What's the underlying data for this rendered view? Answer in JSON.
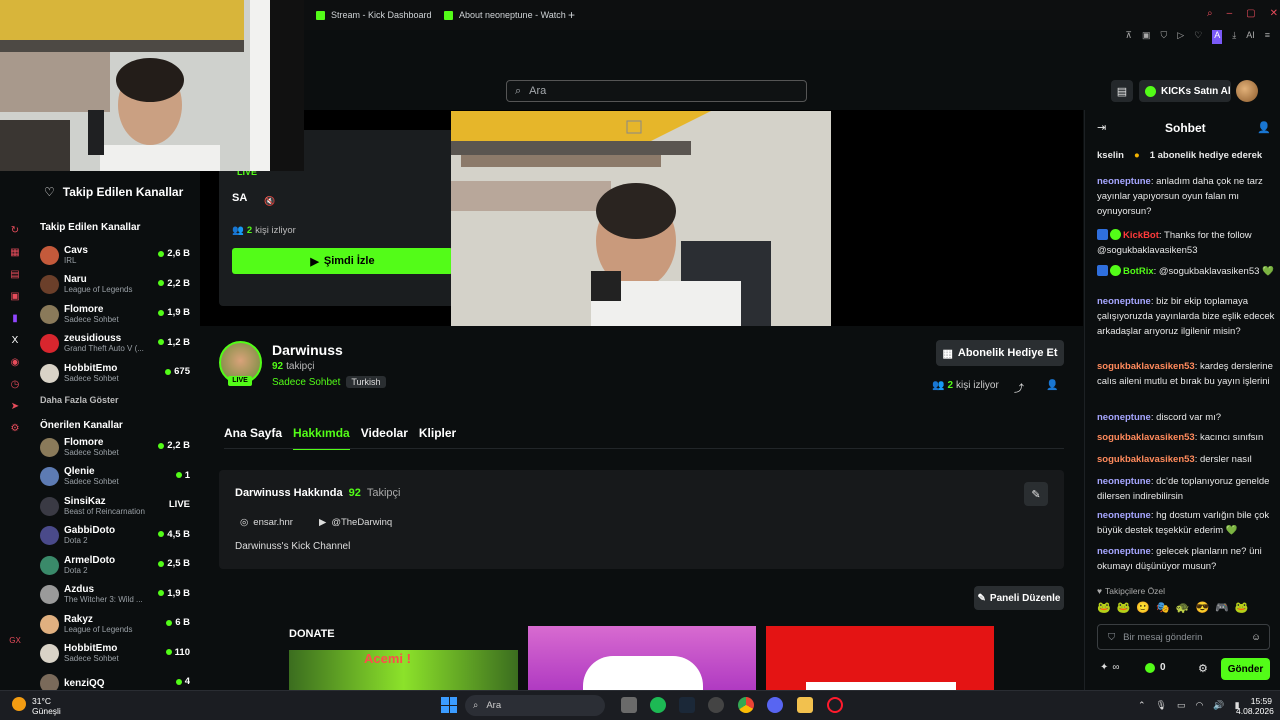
{
  "browser": {
    "tabs": [
      {
        "title": "Stream - Kick Dashboard"
      },
      {
        "title": "About neoneptune - Watch"
      }
    ],
    "new_tab": "+"
  },
  "header": {
    "search_placeholder": "Ara",
    "kicks_button": "KICKs Satın Al"
  },
  "sidebar": {
    "followed_header": "Takip Edilen Kanallar",
    "followed_section": "Takip Edilen Kanallar",
    "followed": [
      {
        "name": "Cavs",
        "category": "IRL",
        "viewers": "2,6 B",
        "color": "#c45a3b"
      },
      {
        "name": "Naru",
        "category": "League of Legends",
        "viewers": "2,2 B",
        "color": "#6b3f2a"
      },
      {
        "name": "Flomore",
        "category": "Sadece Sohbet",
        "viewers": "1,9 B",
        "color": "#8a7a5a"
      },
      {
        "name": "zeusidiouss",
        "category": "Grand Theft Auto V (...",
        "viewers": "1,2 B",
        "color": "#d8262e"
      },
      {
        "name": "HobbitEmo",
        "category": "Sadece Sohbet",
        "viewers": "675",
        "color": "#d9d3c7"
      }
    ],
    "show_more": "Daha Fazla Göster",
    "recommended_section": "Önerilen Kanallar",
    "recommended": [
      {
        "name": "Flomore",
        "category": "Sadece Sohbet",
        "viewers": "2,2 B",
        "color": "#8a7a5a"
      },
      {
        "name": "Qlenie",
        "category": "Sadece Sohbet",
        "viewers": "1",
        "color": "#5d7bb3"
      },
      {
        "name": "SinsiKaz",
        "category": "Beast of Reincarnation",
        "viewers": "LIVE",
        "color": "#3a3a44"
      },
      {
        "name": "GabbiDoto",
        "category": "Dota 2",
        "viewers": "4,5 B",
        "color": "#4a4a8a"
      },
      {
        "name": "ArmelDoto",
        "category": "Dota 2",
        "viewers": "2,5 B",
        "color": "#3a8a6a"
      },
      {
        "name": "Azdus",
        "category": "The Witcher 3: Wild ...",
        "viewers": "1,9 B",
        "color": "#9a9a9a"
      },
      {
        "name": "Rakyz",
        "category": "League of Legends",
        "viewers": "6 B",
        "color": "#e0b080"
      },
      {
        "name": "HobbitEmo",
        "category": "Sadece Sohbet",
        "viewers": "110",
        "color": "#d9d3c7"
      },
      {
        "name": "kenziQQ",
        "category": "",
        "viewers": "4",
        "color": "#7a6a5a"
      }
    ]
  },
  "minicard": {
    "live": "LIVE",
    "title": "SA",
    "viewers_count": "2",
    "viewers_label": "kişi izliyor",
    "watch_button": "Şimdi İzle"
  },
  "channel": {
    "name": "Darwinuss",
    "followers_count": "92",
    "followers_label": "takipçi",
    "category": "Sadece Sohbet",
    "language": "Turkish",
    "live": "LIVE",
    "sub_button": "Abonelik Hediye Et",
    "viewers_count": "2",
    "viewers_label": "kişi izliyor",
    "tabs": [
      "Ana Sayfa",
      "Hakkımda",
      "Videolar",
      "Klipler"
    ],
    "about_title": "Darwinuss Hakkında",
    "about_followers": "92",
    "about_followers_label": "Takipçi",
    "instagram": "ensar.hnr",
    "youtube": "@TheDarwinq",
    "bio": "Darwinuss's Kick Channel",
    "edit_panels": "Paneli Düzenle",
    "donate_label": "DONATE",
    "panel_text": "Acemi !"
  },
  "chat": {
    "title": "Sohbet",
    "ticker_left": "kselin",
    "ticker_right": "1 abonelik hediye ederek",
    "messages": [
      {
        "user": "neoneptune",
        "text": ": anladım daha çok ne tarz yayınlar yapıyorsun oyun falan mı oynuyorsun?",
        "cls": "u-neo"
      },
      {
        "user": "KickBot",
        "text": ": Thanks for the follow @sogukbaklavasiken53",
        "cls": "u-kickbot"
      },
      {
        "user": "BotRix",
        "text": ": @sogukbaklavasiken53 💚",
        "cls": "u-botrix"
      },
      {
        "user": "neoneptune",
        "text": ": biz bir ekip toplamaya çalışıyoruzda yayınlarda bize eşlik edecek arkadaşlar arıyoruz ilgilenir misin?",
        "cls": "u-neo"
      },
      {
        "user": "sogukbaklavasiken53",
        "text": ": kardeş derslerine calıs aileni mutlu et bırak bu yayın işlerini",
        "cls": "u-sog"
      },
      {
        "user": "neoneptune",
        "text": ": discord var mı?",
        "cls": "u-neo"
      },
      {
        "user": "sogukbaklavasiken53",
        "text": ": kacıncı sınıfsın",
        "cls": "u-sog"
      },
      {
        "user": "sogukbaklavasiken53",
        "text": ": dersler nasıl",
        "cls": "u-sog"
      },
      {
        "user": "neoneptune",
        "text": ": dc'de toplanıyoruz genelde dilersen indirebilirsin",
        "cls": "u-neo"
      },
      {
        "user": "neoneptune",
        "text": ": hg dostum varlığın bile çok büyük destek teşekkür ederim 💚",
        "cls": "u-neo"
      },
      {
        "user": "neoneptune",
        "text": ": gelecek planların ne? üni okumayı düşünüyor musun?",
        "cls": "u-neo"
      }
    ],
    "followers_only": "Takipçilere Özel",
    "input_placeholder": "Bir mesaj gönderin",
    "kicks_count": "0",
    "send_button": "Gönder"
  },
  "taskbar": {
    "weather_temp": "31°C",
    "weather_desc": "Güneşli",
    "search": "Ara",
    "time": "15:59",
    "date": "4.08.2026"
  },
  "colors": {
    "accent": "#53fc18",
    "bg": "#0b0e0f"
  }
}
